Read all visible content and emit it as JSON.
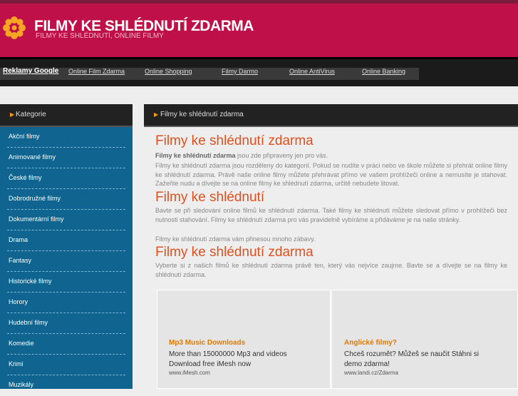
{
  "header": {
    "title": "FILMY KE SHLÉDNUTÍ ZDARMA",
    "subtitle": "FILMY KE SHLÉDNUTÍ, ONLINE FILMY",
    "logo_icon": "flower-icon",
    "colors": {
      "header": "#c0104a",
      "accent": "#e0501f",
      "sidebar": "#0f6590"
    }
  },
  "nav": {
    "ads_label": "Reklamy Google",
    "links": [
      "Online Film Zdarma",
      "Online Shopping",
      "Filmy Darmo",
      "Online AntiVirus",
      "Online Banking"
    ]
  },
  "sidebar": {
    "heading": "Kategorie",
    "items": [
      "Akční filmy",
      "Animované filmy",
      "České filmy",
      "Dobrodružné filmy",
      "Dokumentární filmy",
      "Drama",
      "Fantasy",
      "Historické filmy",
      "Horory",
      "Hudební filmy",
      "Komedie",
      "Krimi",
      "Muzikály"
    ]
  },
  "content": {
    "breadcrumb": "Filmy ke shlédnutí zdarma",
    "section1": {
      "title": "Filmy ke shlédnutí zdarma",
      "lead_bold": "Filmy ke shlédnutí zdarma",
      "lead_rest": " jsou zde připraveny jen pro vás.",
      "text": "Filmy ke shlédnutí zdarma jsou rozděleny do kategorií. Pokud se nudíte v práci nebo ve škole můžete si přehrát online filmy ke shlédnutí zdarma. Právě naše online filmy můžete přehrávat přímo ve vašem prohlížeči online a nemusíte je stahovat. Zažeňte nudu a dívejte se na online filmy ke shlédnutí zdarma, určitě nebudete litovat."
    },
    "section2": {
      "title": "Filmy ke shlédnutí",
      "text": "Bavte se při sledování online filmů ke shlédnutí zdarma. Také filmy ke shlédnutí můžete sledovat přímo v prohlížeči bez nutnosti stahování. Filmy ke shlédnutí zdarma pro vás pravidelně vybíráme a přidáváme je na naše stránky.",
      "text2": "Filmy ke shlédnutí zdarma vám přinesou mnoho zábavy."
    },
    "section3": {
      "title": "Filmy ke shlédnutí zdarma",
      "text": "Vyberte si z našich filmů ke shlédnutí zdarma právě ten, který vás nejvíce zaujme. Bavte se a dívejte se na filmy ke shlédnutí zdarma."
    }
  },
  "ads": [
    {
      "title": "Mp3 Music Downloads",
      "text": "More than 15000000 Mp3 and videos Download free iMesh now",
      "url": "www.iMesh.com"
    },
    {
      "title": "Anglické filmy?",
      "text": "Chceš rozumět? Můžeš se naučit Stáhni si demo zdarma!",
      "url": "www.landi.cz/Zdarma"
    }
  ]
}
